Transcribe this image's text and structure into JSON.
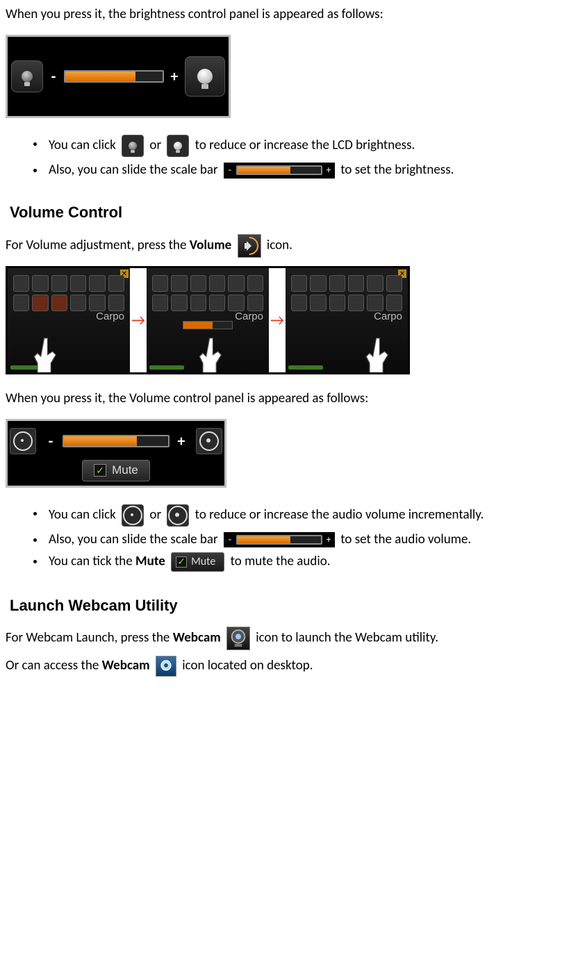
{
  "intro_brightness": "When you press it, the brightness control panel is appeared as follows:",
  "brightness_panel": {
    "minus": "-",
    "plus": "+",
    "fill_pct": 72
  },
  "bullets_brightness": {
    "b1a": "You can click",
    "b1_or": "or",
    "b1b": "to reduce or increase the LCD brightness.",
    "b2a": "Also, you can slide the scale bar",
    "b2b": "to set the brightness."
  },
  "heading_volume": "Volume Control",
  "volume_sentence": {
    "a": "For Volume adjustment, press the ",
    "b": "Volume",
    "c": " icon."
  },
  "seq": {
    "label": "Carpo",
    "arrow": "→"
  },
  "intro_volume_panel": "When you press it, the Volume control panel is appeared as follows:",
  "volume_panel": {
    "minus": "-",
    "plus": "+",
    "fill_pct": 70,
    "mute_label": "Mute",
    "mute_checked": true
  },
  "bullets_volume": {
    "b1a": "You can click",
    "b1_or": "or",
    "b1b": "to reduce or increase the audio volume incrementally.",
    "b2a": "Also, you can slide the scale bar",
    "b2b": "to set the audio volume.",
    "b3a": "You can tick the ",
    "b3_bold": "Mute",
    "b3b": " to mute the audio."
  },
  "heading_webcam": "Launch Webcam Utility",
  "webcam_sentence1": {
    "a": "For Webcam Launch, press the ",
    "b": "Webcam",
    "c": " icon to launch the Webcam utility."
  },
  "webcam_sentence2": {
    "a": "Or can access the ",
    "b": "Webcam",
    "c": " icon located on desktop."
  },
  "inline_scale_fill_pct": 63
}
